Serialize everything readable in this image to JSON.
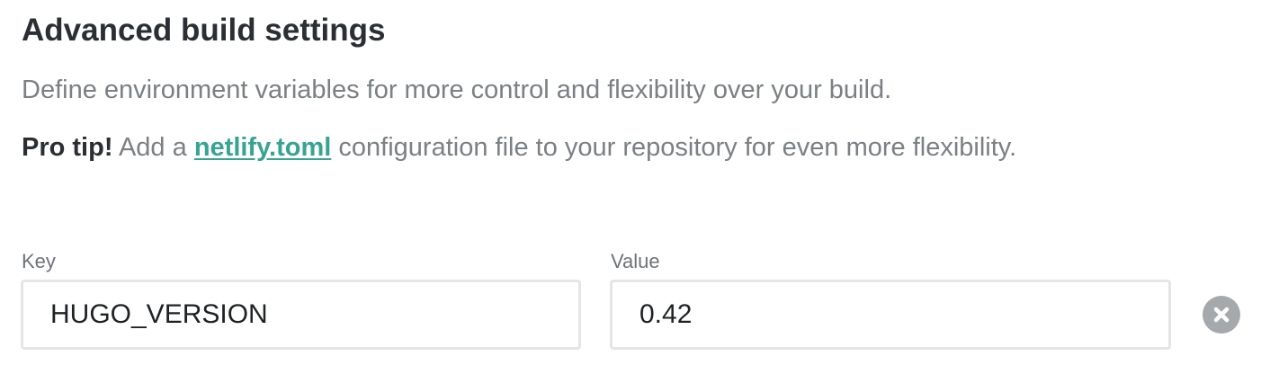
{
  "section": {
    "title": "Advanced build settings",
    "description": "Define environment variables for more control and flexibility over your build.",
    "tip": {
      "prefix": "Pro tip!",
      "text_before": " Add a ",
      "link": "netlify.toml",
      "text_after": " configuration file to your repository for even more flexibility."
    }
  },
  "env_var": {
    "key_label": "Key",
    "key_value": "HUGO_VERSION",
    "value_label": "Value",
    "value_value": "0.42",
    "remove_icon": "close-circle-icon"
  },
  "colors": {
    "link": "#37a493",
    "heading": "#2b2f33",
    "muted": "#7b8084",
    "border": "#e4e5e6",
    "remove": "#a6a9ac"
  }
}
